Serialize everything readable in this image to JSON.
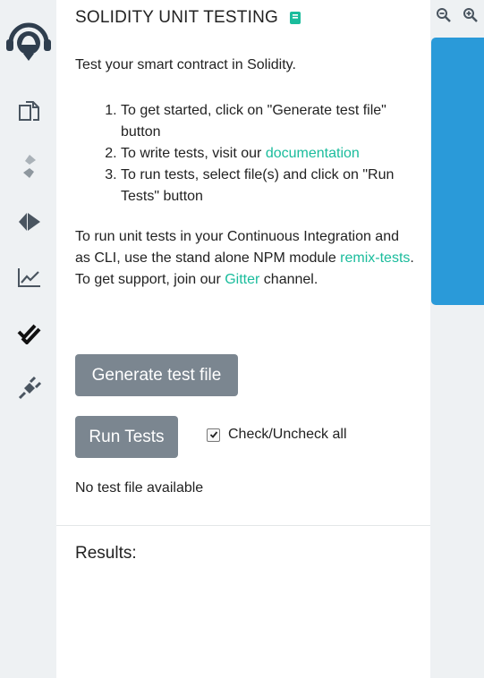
{
  "panel": {
    "title": "SOLIDITY UNIT TESTING",
    "intro": "Test your smart contract in Solidity.",
    "steps": {
      "s1": "To get started, click on \"Generate test file\" button",
      "s2_prefix": "To write tests, visit our ",
      "s2_link": "documentation",
      "s3": "To run tests, select file(s) and click on \"Run Tests\" button"
    },
    "ci": {
      "line1": "To run unit tests in your Continuous Integration and as CLI, use the stand alone NPM module ",
      "link1": "remix-tests",
      "after_link1": ".",
      "support_prefix": "To get support, join our ",
      "link2": "Gitter",
      "support_suffix": " channel."
    },
    "buttons": {
      "generate": "Generate test file",
      "run": "Run Tests"
    },
    "check_all": {
      "label": "Check/Uncheck all",
      "checked": true
    },
    "status": "No test file available",
    "results_label": "Results:"
  },
  "icons": {
    "logo": "remix-logo-icon",
    "files": "file-explorer-icon",
    "compile": "solidity-compiler-icon",
    "deploy": "deploy-run-icon",
    "analysis": "analysis-chart-icon",
    "testing": "double-check-icon",
    "plugins": "plug-icon",
    "zoom_out": "zoom-out-icon",
    "zoom_in": "zoom-in-icon",
    "docs": "book-icon"
  },
  "colors": {
    "accent": "#1abc9c",
    "button": "#7b8690",
    "editor_blue": "#2a9ad9"
  }
}
